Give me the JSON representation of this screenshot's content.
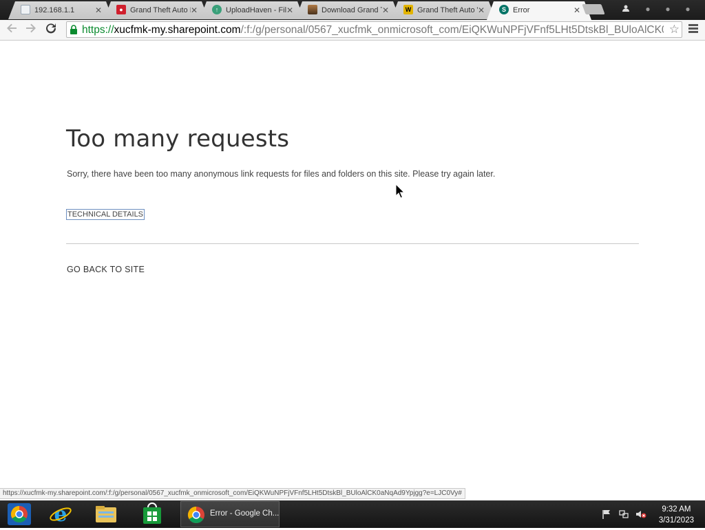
{
  "browser": {
    "tabs": [
      {
        "title": "192.168.1.1",
        "favicon": "blank-page-icon",
        "color": "#9aa7b4",
        "active": false
      },
      {
        "title": "Grand Theft Auto I",
        "favicon": "red-lock-icon",
        "color": "#d01f2d",
        "active": false
      },
      {
        "title": "UploadHaven - File",
        "favicon": "uploadhaven-icon",
        "color": "#3aa07a",
        "active": false
      },
      {
        "title": "Download Grand T",
        "favicon": "game-thumbnail-icon",
        "color": "#6b4b2a",
        "active": false
      },
      {
        "title": "Grand Theft Auto V",
        "favicon": "yellow-logo-icon",
        "color": "#e3b400",
        "active": false
      },
      {
        "title": "Error",
        "favicon": "sharepoint-icon",
        "color": "#077568",
        "active": true
      }
    ],
    "tab_close_glyph": "✕",
    "url": {
      "scheme": "https://",
      "host": "xucfmk-my.sharepoint.com",
      "path": "/:f:/g/personal/0567_xucfmk_onmicrosoft_com/EiQKWuNPFjVFnf5LHt5DtskBl_BUloAlCK0aNqA"
    },
    "status_url": "https://xucfmk-my.sharepoint.com/:f:/g/personal/0567_xucfmk_onmicrosoft_com/EiQKWuNPFjVFnf5LHt5DtskBl_BUloAlCK0aNqAd9Ypjgg?e=LJC0Vy#"
  },
  "page": {
    "title": "Too many requests",
    "message": "Sorry, there have been too many anonymous link requests for files and folders on this site. Please try again later.",
    "technical_details_label": "TECHNICAL DETAILS",
    "back_link_label": "GO BACK TO SITE"
  },
  "taskbar": {
    "pinned": [
      "chrome-icon",
      "internet-explorer-icon",
      "file-explorer-icon",
      "store-icon"
    ],
    "active_window_label": "Error - Google Ch...",
    "clock_time": "9:32 AM",
    "clock_date": "3/31/2023"
  }
}
